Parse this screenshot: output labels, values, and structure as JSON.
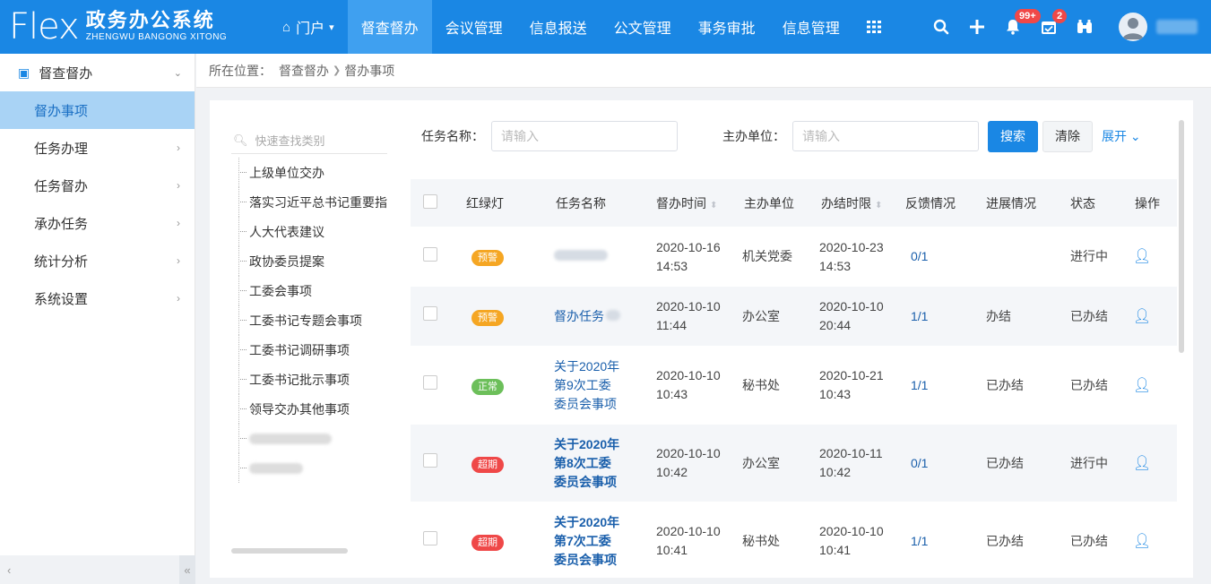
{
  "header": {
    "logo_mark": "Flex",
    "logo_cn": "政务办公系统",
    "logo_en": "ZHENGWU BANGONG XITONG",
    "nav": [
      {
        "label": "门户",
        "has_home_icon": true,
        "has_caret": true
      },
      {
        "label": "督查督办",
        "active": true
      },
      {
        "label": "会议管理"
      },
      {
        "label": "信息报送"
      },
      {
        "label": "公文管理"
      },
      {
        "label": "事务审批"
      },
      {
        "label": "信息管理"
      }
    ],
    "notifications_badge": "99+",
    "calendar_badge": "2",
    "accent_color": "#1a87e4"
  },
  "sidebar": {
    "section": "督查督办",
    "items": [
      {
        "label": "督办事项",
        "active": true
      },
      {
        "label": "任务办理"
      },
      {
        "label": "任务督办"
      },
      {
        "label": "承办任务"
      },
      {
        "label": "统计分析"
      },
      {
        "label": "系统设置"
      }
    ]
  },
  "breadcrumb": {
    "prefix": "所在位置：",
    "items": [
      "督查督办",
      "督办事项"
    ]
  },
  "tree": {
    "search_placeholder": "快速查找类别",
    "items": [
      "上级单位交办",
      "落实习近平总书记重要指",
      "人大代表建议",
      "政协委员提案",
      "工委会事项",
      "工委书记专题会事项",
      "工委书记调研事项",
      "工委书记批示事项",
      "领导交办其他事项"
    ]
  },
  "filters": {
    "task_name_label": "任务名称：",
    "task_name_placeholder": "请输入",
    "unit_label": "主办单位：",
    "unit_placeholder": "请输入",
    "search_button": "搜索",
    "clear_button": "清除",
    "expand_button": "展开"
  },
  "table": {
    "columns": [
      "红绿灯",
      "任务名称",
      "督办时间",
      "主办单位",
      "办结时限",
      "反馈情况",
      "进展情况",
      "状态",
      "操作"
    ],
    "rows": [
      {
        "light": "预警",
        "light_color": "#f5a623",
        "name": "",
        "name_blurred": true,
        "time": "2020-10-16 14:53",
        "unit": "机关党委",
        "deadline": "2020-10-23 14:53",
        "feedback": "0/1",
        "progress": "",
        "status": "进行中"
      },
      {
        "light": "预警",
        "light_color": "#f5a623",
        "name": "督办任务",
        "time": "2020-10-10 11:44",
        "unit": "办公室",
        "deadline": "2020-10-10 20:44",
        "feedback": "1/1",
        "progress": "办结",
        "status": "已办结"
      },
      {
        "light": "正常",
        "light_color": "#6cbf5a",
        "name": "关于2020年第9次工委委员会事项",
        "time": "2020-10-10 10:43",
        "unit": "秘书处",
        "deadline": "2020-10-21 10:43",
        "feedback": "1/1",
        "progress": "已办结",
        "status": "已办结"
      },
      {
        "light": "超期",
        "light_color": "#ef4848",
        "name": "关于2020年第8次工委委员会事项",
        "bold": true,
        "time": "2020-10-10 10:42",
        "unit": "办公室",
        "deadline": "2020-10-11 10:42",
        "feedback": "0/1",
        "progress": "已办结",
        "status": "进行中"
      },
      {
        "light": "超期",
        "light_color": "#ef4848",
        "name": "关于2020年第7次工委委员会事项",
        "bold": true,
        "time": "2020-10-10 10:41",
        "unit": "秘书处",
        "deadline": "2020-10-10 10:41",
        "feedback": "1/1",
        "progress": "已办结",
        "status": "已办结"
      }
    ]
  }
}
